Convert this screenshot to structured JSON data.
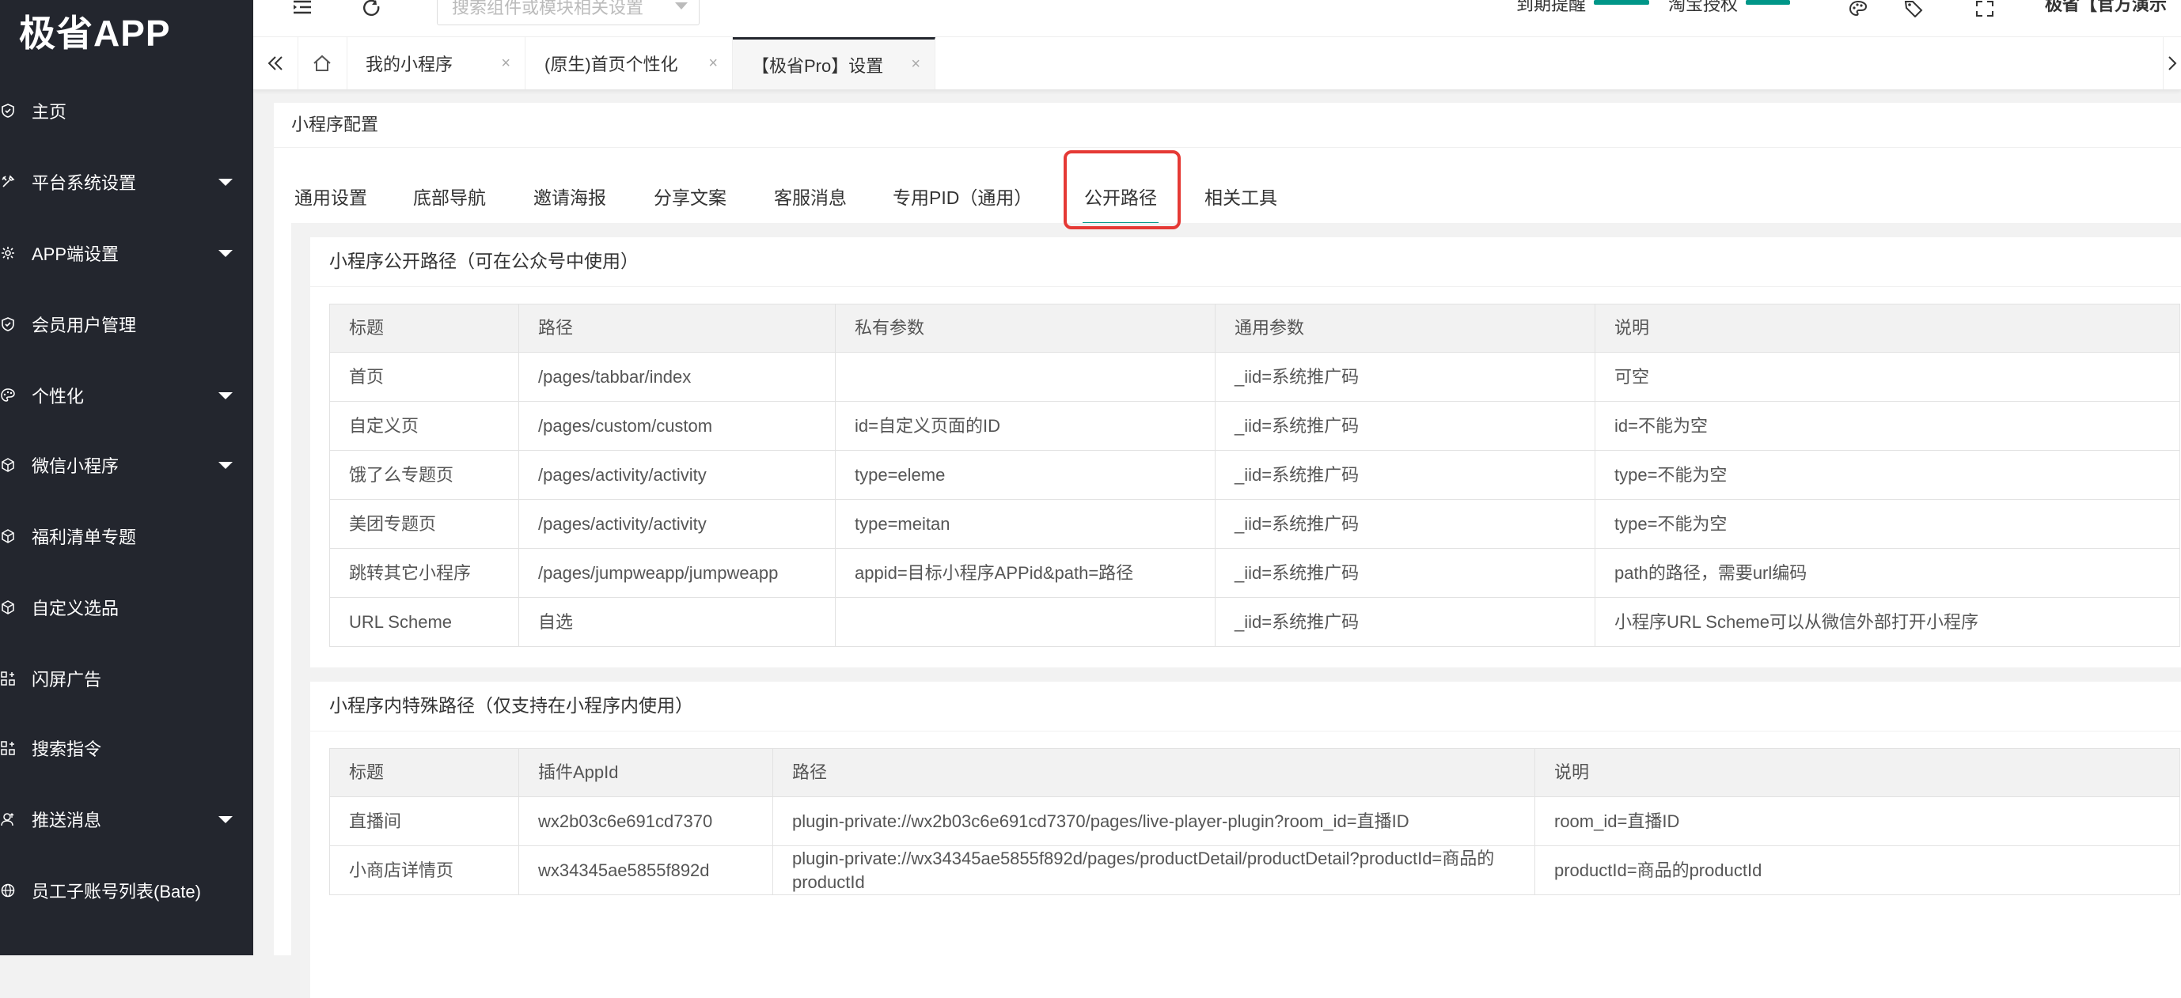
{
  "app": {
    "logo": "极省APP"
  },
  "colors": {
    "sidebar_bg": "#23262e",
    "accent": "#009688",
    "highlight": "#e53935"
  },
  "sidebar": {
    "items": [
      {
        "icon": "shield-icon",
        "label": "主页",
        "has_caret": false
      },
      {
        "icon": "tools-icon",
        "label": "平台系统设置",
        "has_caret": true
      },
      {
        "icon": "gear-icon",
        "label": "APP端设置",
        "has_caret": true
      },
      {
        "icon": "shield-icon",
        "label": "会员用户管理",
        "has_caret": false
      },
      {
        "icon": "palette-icon",
        "label": "个性化",
        "has_caret": true
      },
      {
        "icon": "cube-icon",
        "label": "微信小程序",
        "has_caret": true
      },
      {
        "icon": "cube-icon",
        "label": "福利清单专题",
        "has_caret": false
      },
      {
        "icon": "cube-icon",
        "label": "自定义选品",
        "has_caret": false
      },
      {
        "icon": "apps-icon",
        "label": "闪屏广告",
        "has_caret": false
      },
      {
        "icon": "apps-icon",
        "label": "搜索指令",
        "has_caret": false
      },
      {
        "icon": "user-icon",
        "label": "推送消息",
        "has_caret": true
      },
      {
        "icon": "globe-icon",
        "label": "员工子账号列表(Bate)",
        "has_caret": false
      }
    ]
  },
  "topbar": {
    "search_placeholder": "搜索组件或模块相关设置",
    "expire_label": "到期提醒",
    "taobao_label": "淘宝授权",
    "user_label": "极省【官方演示"
  },
  "page_tabs": [
    {
      "label": "我的小程序",
      "active": false
    },
    {
      "label": "(原生)首页个性化",
      "active": false
    },
    {
      "label": "【极省Pro】设置",
      "active": true
    }
  ],
  "tab_close": "×",
  "panel": {
    "title": "小程序配置",
    "tabs": [
      "通用设置",
      "底部导航",
      "邀请海报",
      "分享文案",
      "客服消息",
      "专用PID（通用）",
      "公开路径",
      "相关工具"
    ],
    "active_tab": "公开路径"
  },
  "public_paths": {
    "title": "小程序公开路径（可在公众号中使用）",
    "headers": [
      "标题",
      "路径",
      "私有参数",
      "通用参数",
      "说明"
    ],
    "rows": [
      [
        "首页",
        "/pages/tabbar/index",
        "",
        "_iid=系统推广码",
        "可空"
      ],
      [
        "自定义页",
        "/pages/custom/custom",
        "id=自定义页面的ID",
        "_iid=系统推广码",
        "id=不能为空"
      ],
      [
        "饿了么专题页",
        "/pages/activity/activity",
        "type=eleme",
        "_iid=系统推广码",
        "type=不能为空"
      ],
      [
        "美团专题页",
        "/pages/activity/activity",
        "type=meitan",
        "_iid=系统推广码",
        "type=不能为空"
      ],
      [
        "跳转其它小程序",
        "/pages/jumpweapp/jumpweapp",
        "appid=目标小程序APPid&path=路径",
        "_iid=系统推广码",
        "path的路径，需要url编码"
      ],
      [
        "URL Scheme",
        "自选",
        "",
        "_iid=系统推广码",
        "小程序URL Scheme可以从微信外部打开小程序"
      ]
    ]
  },
  "special_paths": {
    "title": "小程序内特殊路径（仅支持在小程序内使用）",
    "headers": [
      "标题",
      "插件AppId",
      "路径",
      "说明"
    ],
    "rows": [
      [
        "直播间",
        "wx2b03c6e691cd7370",
        "plugin-private://wx2b03c6e691cd7370/pages/live-player-plugin?room_id=直播ID",
        "room_id=直播ID"
      ],
      [
        "小商店详情页",
        "wx34345ae5855f892d",
        "plugin-private://wx34345ae5855f892d/pages/productDetail/productDetail?productId=商品的productId",
        "productId=商品的productId"
      ]
    ]
  }
}
